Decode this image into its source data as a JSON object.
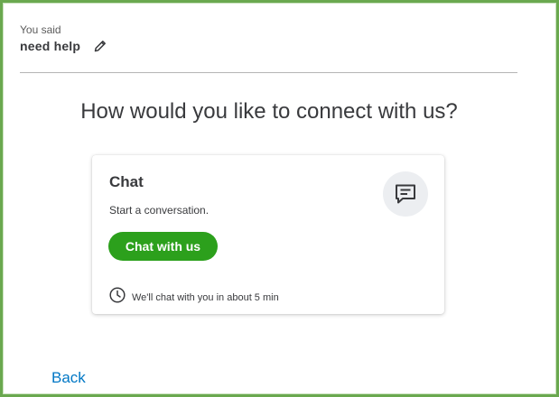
{
  "query": {
    "label": "You said",
    "value": "need help",
    "edit_icon": "pencil-icon"
  },
  "heading": "How would you like to connect with us?",
  "chat_card": {
    "title": "Chat",
    "description": "Start a conversation.",
    "icon": "chat-bubble-icon",
    "button_label": "Chat with us",
    "wait_icon": "clock-icon",
    "wait_text": "We'll chat with you in about 5 min"
  },
  "back_label": "Back",
  "colors": {
    "accent_green": "#2ca01c",
    "link_blue": "#0077c5",
    "frame_green": "#6aa84f",
    "text": "#393a3d"
  }
}
